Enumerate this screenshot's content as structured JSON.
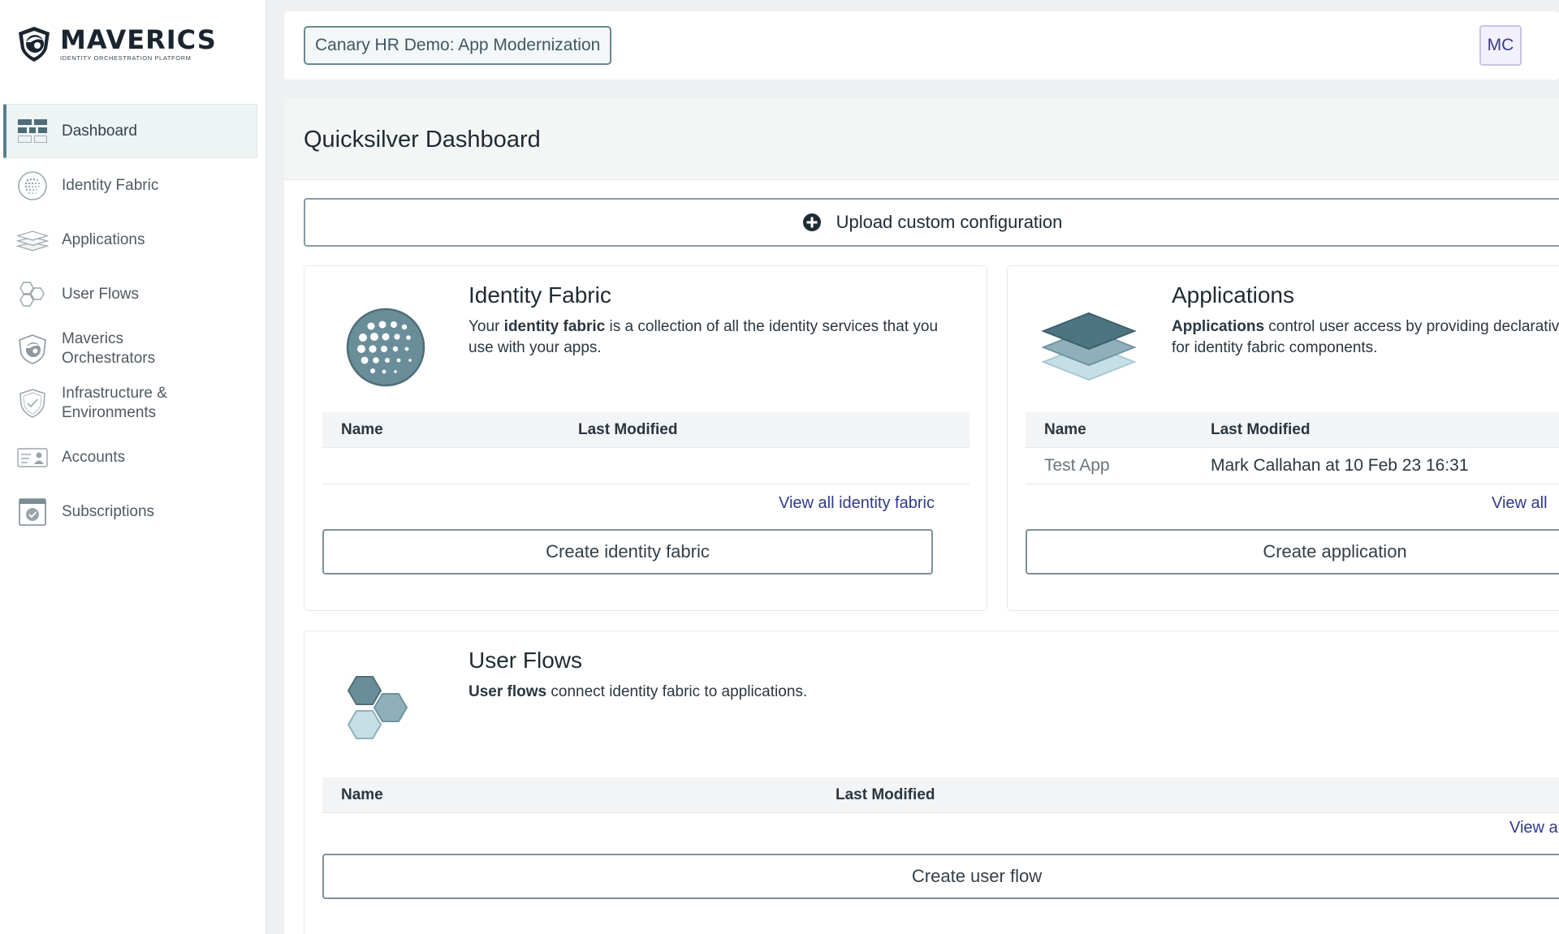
{
  "brand": {
    "name": "MAVERICS",
    "tagline": "IDENTITY ORCHESTRATION PLATFORM"
  },
  "header": {
    "workspace": "Canary HR Demo: App Modernization",
    "avatar_initials": "MC"
  },
  "sidebar": {
    "items": [
      {
        "label": "Dashboard",
        "icon": "dashboard-icon",
        "active": true
      },
      {
        "label": "Identity Fabric",
        "icon": "identity-fabric-icon"
      },
      {
        "label": "Applications",
        "icon": "layers-icon"
      },
      {
        "label": "User Flows",
        "icon": "hexagons-icon"
      },
      {
        "label": "Maverics Orchestrators",
        "icon": "orchestrator-eye-icon"
      },
      {
        "label": "Infrastructure & Environments",
        "icon": "shield-check-icon"
      },
      {
        "label": "Accounts",
        "icon": "id-card-icon"
      },
      {
        "label": "Subscriptions",
        "icon": "subscription-check-icon"
      }
    ]
  },
  "page": {
    "title": "Quicksilver Dashboard",
    "upload_label": "Upload custom configuration"
  },
  "cards": {
    "identity_fabric": {
      "title": "Identity Fabric",
      "desc_bold": "identity fabric",
      "desc_pre": "Your ",
      "desc_post": " is a collection of all the identity services that you use with your apps.",
      "col_name": "Name",
      "col_modified": "Last Modified",
      "view_all": "View all identity fabric",
      "create": "Create identity fabric"
    },
    "applications": {
      "title": "Applications",
      "desc_bold": "Applications",
      "desc_post": " control user access by providing declarative",
      "desc_line2": "for identity fabric components.",
      "col_name": "Name",
      "col_modified": "Last Modified",
      "rows": [
        {
          "name": "Test App",
          "modified": "Mark Callahan at 10 Feb 23 16:31"
        }
      ],
      "view_all": "View all",
      "create": "Create application"
    },
    "user_flows": {
      "title": "User Flows",
      "desc_bold": "User flows",
      "desc_post": " connect identity fabric to applications.",
      "col_name": "Name",
      "col_modified": "Last Modified",
      "view_all": "View all",
      "create": "Create user flow"
    }
  },
  "colors": {
    "accent": "#5b7f8c",
    "link": "#2f3a8c",
    "icon_dark": "#4d7480",
    "icon_mid": "#8fb0ba",
    "icon_light": "#c6dfe6"
  }
}
